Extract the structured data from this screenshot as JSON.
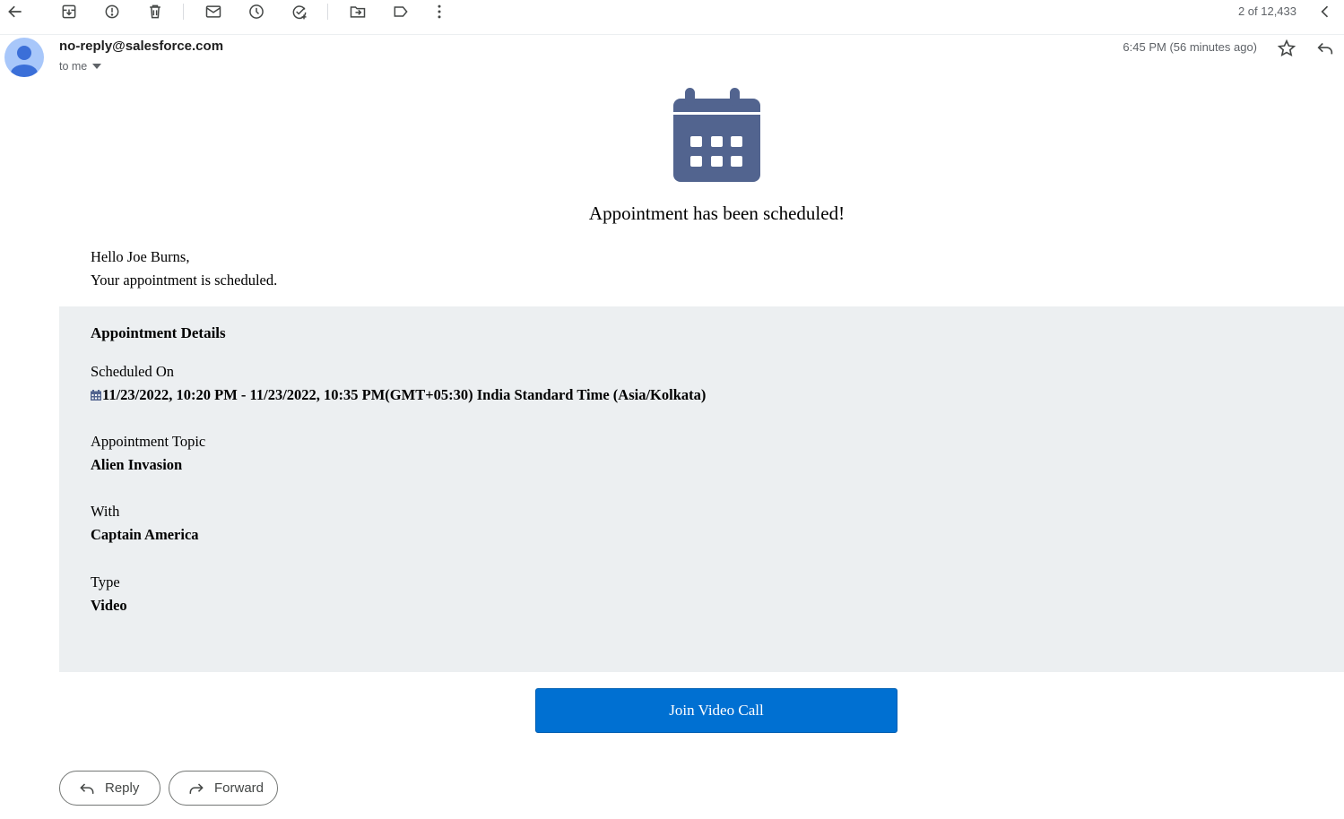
{
  "toolbar": {
    "buttons": [
      {
        "name": "back-button",
        "icon": "arrow-left-icon"
      },
      {
        "name": "archive-button",
        "icon": "archive-icon"
      },
      {
        "name": "report-spam-button",
        "icon": "report-icon"
      },
      {
        "name": "delete-button",
        "icon": "trash-icon"
      },
      {
        "name": "mark-unread-button",
        "icon": "mail-icon"
      },
      {
        "name": "snooze-button",
        "icon": "clock-icon"
      },
      {
        "name": "add-task-button",
        "icon": "task-add-icon"
      },
      {
        "name": "move-to-button",
        "icon": "folder-move-icon"
      },
      {
        "name": "labels-button",
        "icon": "label-icon"
      },
      {
        "name": "more-button",
        "icon": "more-vert-icon"
      }
    ],
    "pager": "2 of 12,433"
  },
  "header": {
    "sender": "no-reply@salesforce.com",
    "recipient": "to me",
    "date": "6:45 PM (56 minutes ago)"
  },
  "email": {
    "headline": "Appointment has been scheduled!",
    "greeting_line1": "Hello Joe Burns,",
    "greeting_line2": "Your appointment is scheduled.",
    "details": {
      "title": "Appointment Details",
      "scheduled_label": "Scheduled On",
      "scheduled_value": "11/23/2022, 10:20 PM - 11/23/2022, 10:35 PM(GMT+05:30) India Standard Time (Asia/Kolkata)",
      "topic_label": "Appointment Topic",
      "topic_value": "Alien Invasion",
      "with_label": "With",
      "with_value": "Captain America",
      "type_label": "Type",
      "type_value": "Video"
    },
    "join_button": "Join Video Call"
  },
  "actions": {
    "reply": "Reply",
    "forward": "Forward"
  },
  "colors": {
    "calendar_icon": "#52648f",
    "details_bg": "#eceff1",
    "join_button": "#0070d2"
  }
}
